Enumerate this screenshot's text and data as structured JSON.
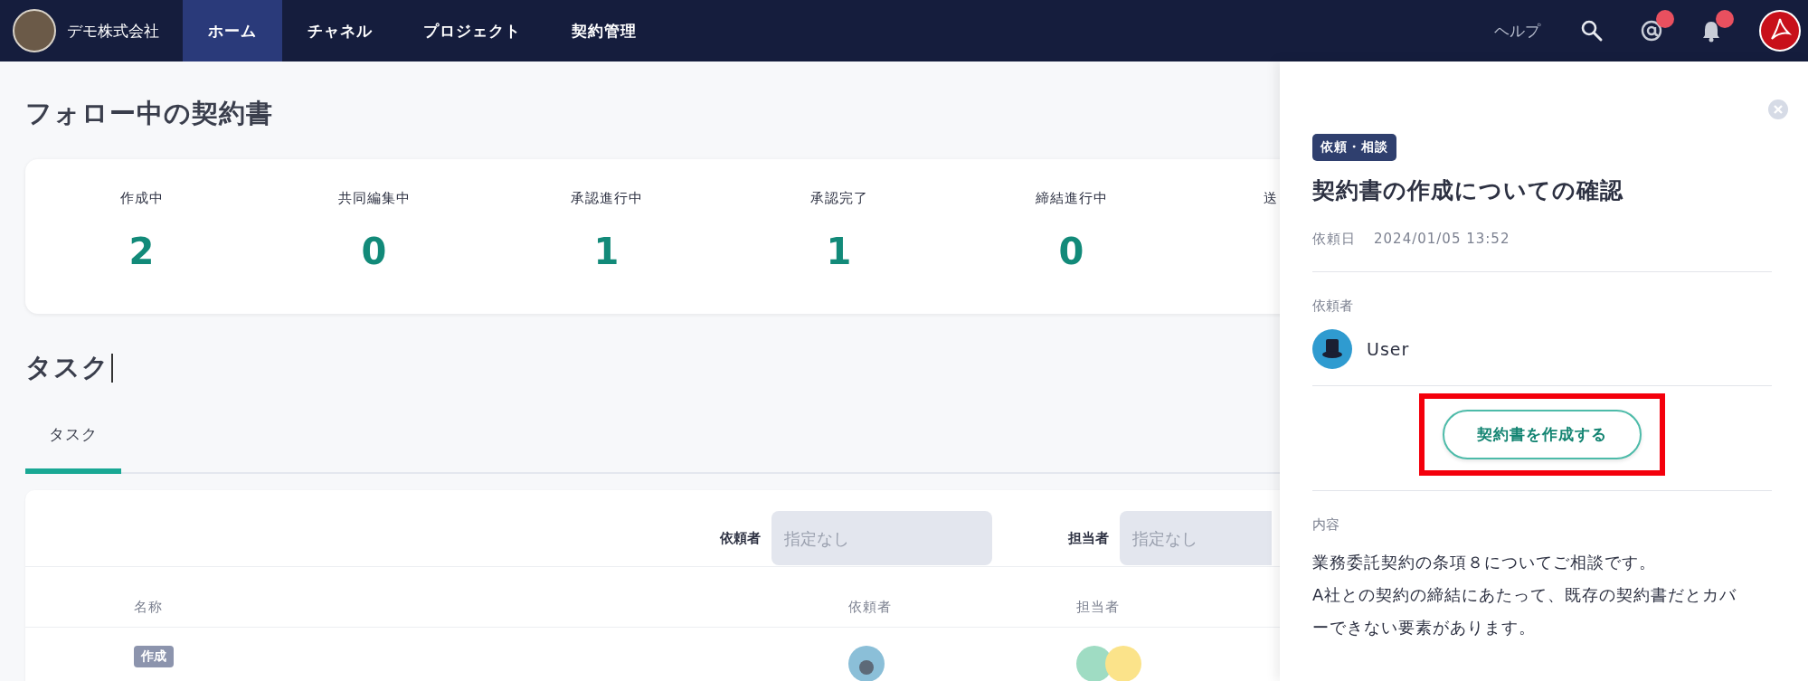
{
  "topbar": {
    "company": "デモ株式会社",
    "nav": [
      {
        "label": "ホーム",
        "selected": true
      },
      {
        "label": "チャネル",
        "selected": false
      },
      {
        "label": "プロジェクト",
        "selected": false
      },
      {
        "label": "契約管理",
        "selected": false
      }
    ],
    "help": "ヘルプ",
    "mention_badge": true,
    "notification_badge": true
  },
  "followed": {
    "heading": "フォロー中の契約書",
    "stats": [
      {
        "label": "作成中",
        "count": "2"
      },
      {
        "label": "共同編集中",
        "count": "0"
      },
      {
        "label": "承認進行中",
        "count": "1"
      },
      {
        "label": "承認完了",
        "count": "1"
      },
      {
        "label": "締結進行中",
        "count": "0"
      },
      {
        "label": "送"
      }
    ]
  },
  "tasks": {
    "heading": "タスク",
    "tabs": [
      {
        "label": "タスク",
        "selected": true
      }
    ],
    "filters": [
      {
        "label": "依頼者",
        "placeholder": "指定なし"
      },
      {
        "label": "担当者",
        "placeholder": "指定なし"
      }
    ],
    "columns": [
      "名称",
      "依頼者",
      "担当者"
    ],
    "rows": [
      {
        "tag": "作成"
      }
    ]
  },
  "panel": {
    "category": "依頼・相談",
    "title": "契約書の作成についての確認",
    "date_label": "依頼日",
    "date": "2024/01/05 13:52",
    "requester_label": "依頼者",
    "requester": "User",
    "action": "契約書を作成する",
    "action_highlighted": true,
    "content_label": "内容",
    "content": [
      "業務委託契約の条項８についてご相談です。",
      "A社との契約の締結にあたって、既存の契約書だとカバーできない要素があります。"
    ]
  }
}
